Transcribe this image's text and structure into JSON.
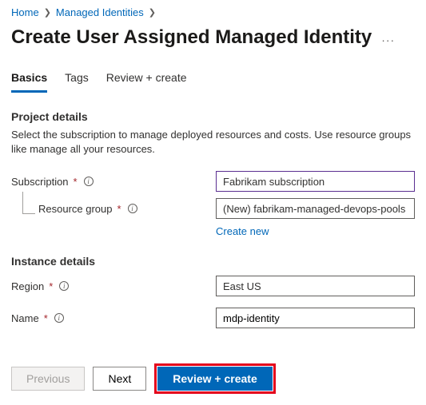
{
  "breadcrumb": {
    "home": "Home",
    "managed_identities": "Managed Identities"
  },
  "page": {
    "title": "Create User Assigned Managed Identity"
  },
  "tabs": {
    "basics": "Basics",
    "tags": "Tags",
    "review": "Review + create"
  },
  "project": {
    "section_title": "Project details",
    "section_desc": "Select the subscription to manage deployed resources and costs. Use resource groups like manage all your resources.",
    "subscription_label": "Subscription",
    "subscription_value": "Fabrikam subscription",
    "resource_group_label": "Resource group",
    "resource_group_value": "(New) fabrikam-managed-devops-pools",
    "create_new": "Create new"
  },
  "instance": {
    "section_title": "Instance details",
    "region_label": "Region",
    "region_value": "East US",
    "name_label": "Name",
    "name_value": "mdp-identity"
  },
  "footer": {
    "previous": "Previous",
    "next": "Next",
    "review_create": "Review + create"
  }
}
